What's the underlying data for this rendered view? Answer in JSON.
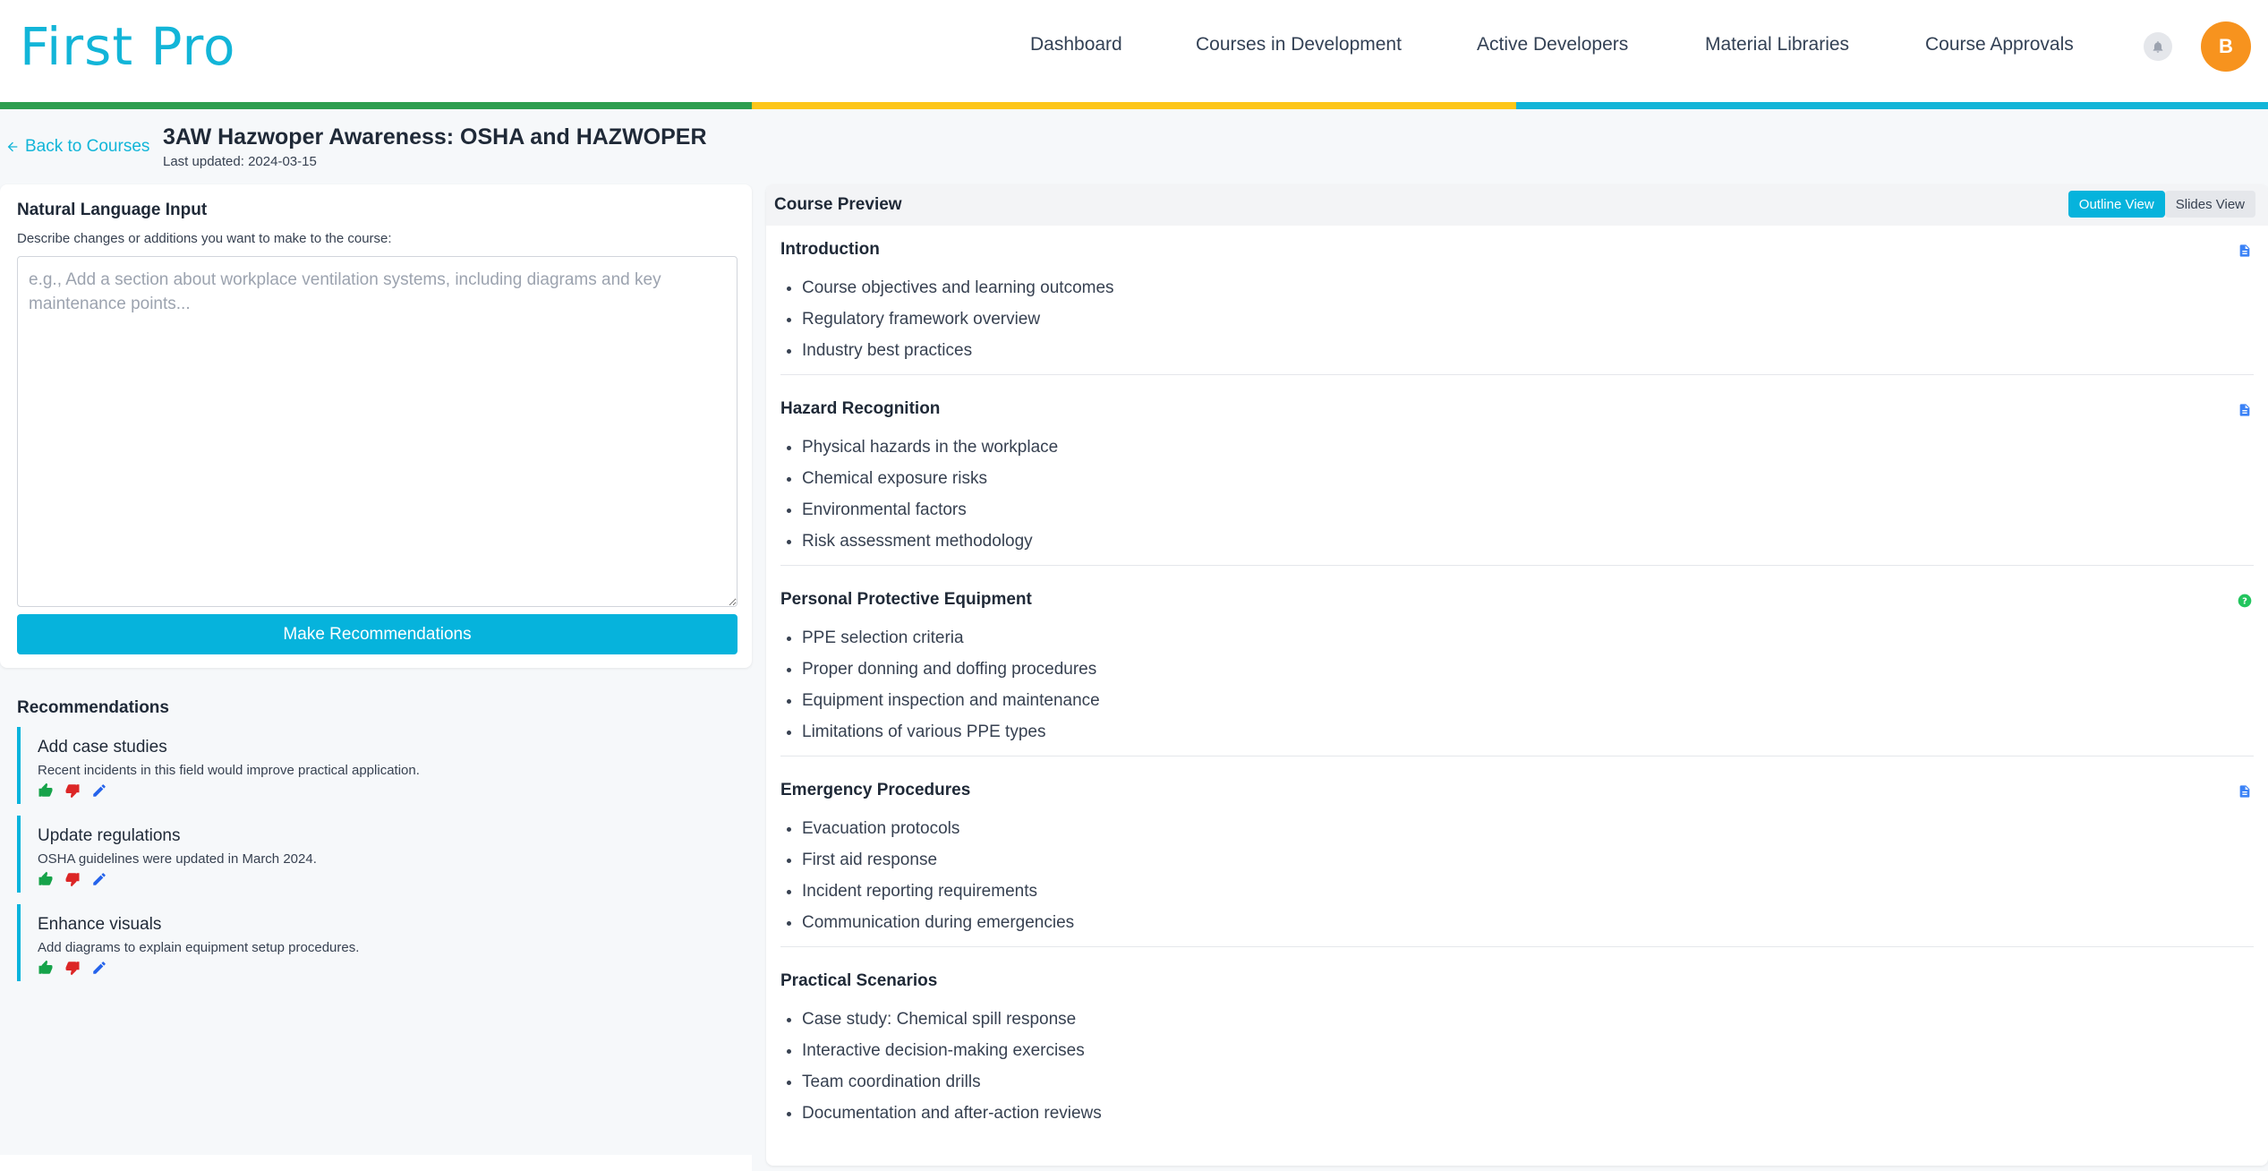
{
  "header": {
    "logo": "First Pro",
    "nav": [
      "Dashboard",
      "Courses in Development",
      "Active Developers",
      "Material Libraries",
      "Course Approvals"
    ],
    "avatar_initial": "B",
    "stripe_colors": [
      "#2e9e4f",
      "#fdc619",
      "#12b5d8"
    ]
  },
  "course": {
    "back_label": "Back to Courses",
    "title": "3AW Hazwoper Awareness: OSHA and HAZWOPER",
    "updated": "Last updated: 2024-03-15"
  },
  "input": {
    "heading": "Natural Language Input",
    "description": "Describe changes or additions you want to make to the course:",
    "placeholder": "e.g., Add a section about workplace ventilation systems, including diagrams and key maintenance points...",
    "value": "",
    "button": "Make Recommendations"
  },
  "recommendations": {
    "heading": "Recommendations",
    "items": [
      {
        "title": "Add case studies",
        "text": "Recent incidents in this field would improve practical application."
      },
      {
        "title": "Update regulations",
        "text": "OSHA guidelines were updated in March 2024."
      },
      {
        "title": "Enhance visuals",
        "text": "Add diagrams to explain equipment setup procedures."
      }
    ]
  },
  "preview": {
    "heading": "Course Preview",
    "views": [
      "Outline View",
      "Slides View"
    ],
    "active_view": "Outline View",
    "sections": [
      {
        "title": "Introduction",
        "icon": "document-icon",
        "items": [
          "Course objectives and learning outcomes",
          "Regulatory framework overview",
          "Industry best practices"
        ]
      },
      {
        "title": "Hazard Recognition",
        "icon": "document-icon",
        "items": [
          "Physical hazards in the workplace",
          "Chemical exposure risks",
          "Environmental factors",
          "Risk assessment methodology"
        ]
      },
      {
        "title": "Personal Protective Equipment",
        "icon": "help-icon",
        "items": [
          "PPE selection criteria",
          "Proper donning and doffing procedures",
          "Equipment inspection and maintenance",
          "Limitations of various PPE types"
        ]
      },
      {
        "title": "Emergency Procedures",
        "icon": "document-icon",
        "items": [
          "Evacuation protocols",
          "First aid response",
          "Incident reporting requirements",
          "Communication during emergencies"
        ]
      },
      {
        "title": "Practical Scenarios",
        "icon": "",
        "items": [
          "Case study: Chemical spill response",
          "Interactive decision-making exercises",
          "Team coordination drills",
          "Documentation and after-action reviews"
        ]
      }
    ]
  }
}
